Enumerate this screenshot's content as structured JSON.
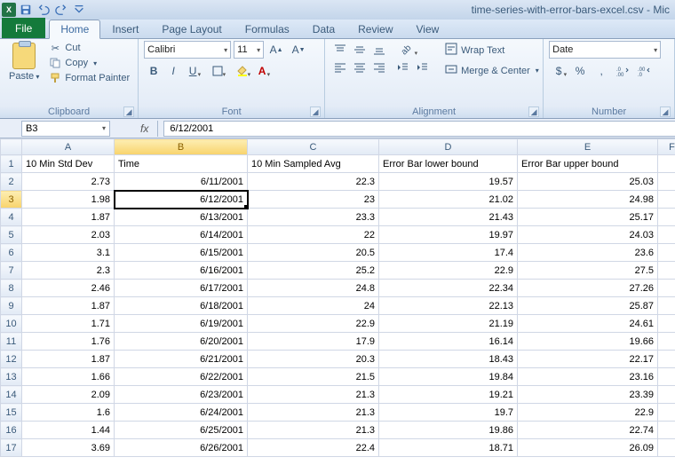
{
  "window": {
    "title": "time-series-with-error-bars-excel.csv - Mic"
  },
  "qat": {
    "excel_glyph": "X"
  },
  "tabs": {
    "file": "File",
    "home": "Home",
    "insert": "Insert",
    "page_layout": "Page Layout",
    "formulas": "Formulas",
    "data": "Data",
    "review": "Review",
    "view": "View"
  },
  "clipboard": {
    "paste": "Paste",
    "cut": "Cut",
    "copy": "Copy",
    "format_painter": "Format Painter",
    "group_label": "Clipboard"
  },
  "font": {
    "name": "Calibri",
    "size": "11",
    "group_label": "Font"
  },
  "alignment": {
    "wrap": "Wrap Text",
    "merge": "Merge & Center",
    "group_label": "Alignment"
  },
  "number": {
    "format": "Date",
    "currency": "$",
    "percent": "%",
    "comma": ",",
    "group_label": "Number"
  },
  "formula_bar": {
    "name_box": "B3",
    "fx": "fx",
    "value": "6/12/2001"
  },
  "columns": [
    "A",
    "B",
    "C",
    "D",
    "E",
    "F"
  ],
  "headers": {
    "A": "10 Min Std Dev",
    "B": "Time",
    "C": "10 Min Sampled Avg",
    "D": "Error Bar lower bound",
    "E": "Error Bar upper bound"
  },
  "selected_cell": {
    "row": 3,
    "col": "B"
  },
  "rows": [
    {
      "n": 2,
      "A": "2.73",
      "B": "6/11/2001",
      "C": "22.3",
      "D": "19.57",
      "E": "25.03"
    },
    {
      "n": 3,
      "A": "1.98",
      "B": "6/12/2001",
      "C": "23",
      "D": "21.02",
      "E": "24.98"
    },
    {
      "n": 4,
      "A": "1.87",
      "B": "6/13/2001",
      "C": "23.3",
      "D": "21.43",
      "E": "25.17"
    },
    {
      "n": 5,
      "A": "2.03",
      "B": "6/14/2001",
      "C": "22",
      "D": "19.97",
      "E": "24.03"
    },
    {
      "n": 6,
      "A": "3.1",
      "B": "6/15/2001",
      "C": "20.5",
      "D": "17.4",
      "E": "23.6"
    },
    {
      "n": 7,
      "A": "2.3",
      "B": "6/16/2001",
      "C": "25.2",
      "D": "22.9",
      "E": "27.5"
    },
    {
      "n": 8,
      "A": "2.46",
      "B": "6/17/2001",
      "C": "24.8",
      "D": "22.34",
      "E": "27.26"
    },
    {
      "n": 9,
      "A": "1.87",
      "B": "6/18/2001",
      "C": "24",
      "D": "22.13",
      "E": "25.87"
    },
    {
      "n": 10,
      "A": "1.71",
      "B": "6/19/2001",
      "C": "22.9",
      "D": "21.19",
      "E": "24.61"
    },
    {
      "n": 11,
      "A": "1.76",
      "B": "6/20/2001",
      "C": "17.9",
      "D": "16.14",
      "E": "19.66"
    },
    {
      "n": 12,
      "A": "1.87",
      "B": "6/21/2001",
      "C": "20.3",
      "D": "18.43",
      "E": "22.17"
    },
    {
      "n": 13,
      "A": "1.66",
      "B": "6/22/2001",
      "C": "21.5",
      "D": "19.84",
      "E": "23.16"
    },
    {
      "n": 14,
      "A": "2.09",
      "B": "6/23/2001",
      "C": "21.3",
      "D": "19.21",
      "E": "23.39"
    },
    {
      "n": 15,
      "A": "1.6",
      "B": "6/24/2001",
      "C": "21.3",
      "D": "19.7",
      "E": "22.9"
    },
    {
      "n": 16,
      "A": "1.44",
      "B": "6/25/2001",
      "C": "21.3",
      "D": "19.86",
      "E": "22.74"
    },
    {
      "n": 17,
      "A": "3.69",
      "B": "6/26/2001",
      "C": "22.4",
      "D": "18.71",
      "E": "26.09"
    }
  ],
  "chart_data": {
    "type": "table",
    "title": "time-series-with-error-bars-excel.csv",
    "columns": [
      "10 Min Std Dev",
      "Time",
      "10 Min Sampled Avg",
      "Error Bar lower bound",
      "Error Bar upper bound"
    ],
    "data": [
      [
        2.73,
        "6/11/2001",
        22.3,
        19.57,
        25.03
      ],
      [
        1.98,
        "6/12/2001",
        23,
        21.02,
        24.98
      ],
      [
        1.87,
        "6/13/2001",
        23.3,
        21.43,
        25.17
      ],
      [
        2.03,
        "6/14/2001",
        22,
        19.97,
        24.03
      ],
      [
        3.1,
        "6/15/2001",
        20.5,
        17.4,
        23.6
      ],
      [
        2.3,
        "6/16/2001",
        25.2,
        22.9,
        27.5
      ],
      [
        2.46,
        "6/17/2001",
        24.8,
        22.34,
        27.26
      ],
      [
        1.87,
        "6/18/2001",
        24,
        22.13,
        25.87
      ],
      [
        1.71,
        "6/19/2001",
        22.9,
        21.19,
        24.61
      ],
      [
        1.76,
        "6/20/2001",
        17.9,
        16.14,
        19.66
      ],
      [
        1.87,
        "6/21/2001",
        20.3,
        18.43,
        22.17
      ],
      [
        1.66,
        "6/22/2001",
        21.5,
        19.84,
        23.16
      ],
      [
        2.09,
        "6/23/2001",
        21.3,
        19.21,
        23.39
      ],
      [
        1.6,
        "6/24/2001",
        21.3,
        19.7,
        22.9
      ],
      [
        1.44,
        "6/25/2001",
        21.3,
        19.86,
        22.74
      ],
      [
        3.69,
        "6/26/2001",
        22.4,
        18.71,
        26.09
      ]
    ]
  }
}
